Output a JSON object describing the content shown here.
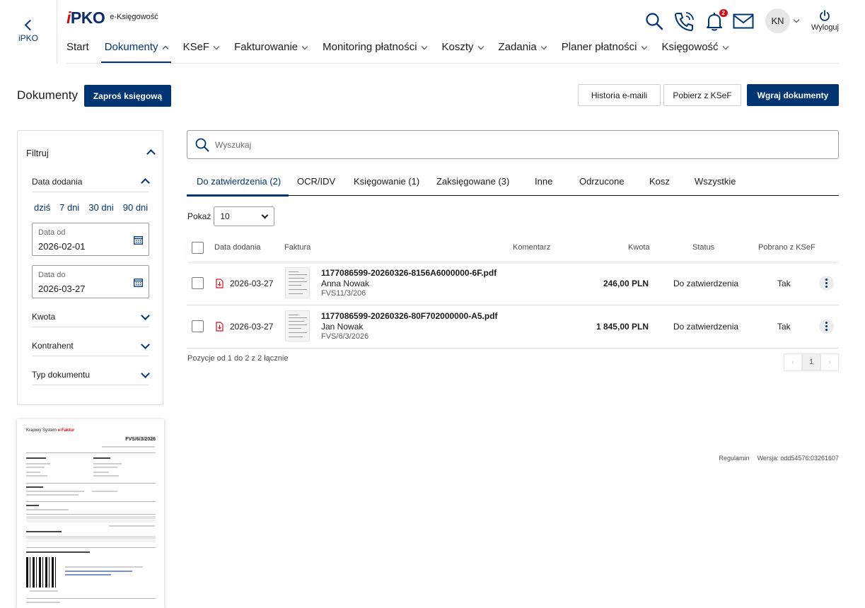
{
  "header": {
    "back_label": "iPKO",
    "brand_i": "i",
    "brand_rest": "PKO",
    "brand_sub": "e-Księgowość",
    "nav": [
      "Start",
      "Dokumenty",
      "KSeF",
      "Fakturowanie",
      "Monitoring płatności",
      "Koszty",
      "Zadania",
      "Planer płatności",
      "Księgowość"
    ],
    "notification_count": "2",
    "avatar_initials": "KN",
    "logout_label": "Wyloguj"
  },
  "page": {
    "title": "Dokumenty",
    "invite_button": "Zaproś księgową",
    "email_history_button": "Historia e-maili",
    "ksef_download_button": "Pobierz z KSeF",
    "upload_button": "Wgraj dokumenty"
  },
  "filters": {
    "title": "Filtruj",
    "date_section": "Data dodania",
    "quick": [
      "dziś",
      "7 dni",
      "30 dni",
      "90 dni"
    ],
    "date_from_label": "Data od",
    "date_from_value": "2026-02-01",
    "date_to_label": "Data do",
    "date_to_value": "2026-03-27",
    "amount": "Kwota",
    "counterparty": "Kontrahent",
    "doc_type": "Typ dokumentu"
  },
  "preview": {
    "title_pre": "Krajowy System ",
    "title_e": "e-Faktur",
    "doc_number": "FVS/6/3/2026"
  },
  "search": {
    "placeholder": "Wyszukaj"
  },
  "tabs": [
    "Do zatwierdzenia (2)",
    "OCR/IDV",
    "Księgowanie (1)",
    "Zaksięgowane (3)",
    "Inne",
    "Odrzucone",
    "Kosz",
    "Wszystkie"
  ],
  "show": {
    "label": "Pokaż",
    "value": "10"
  },
  "table": {
    "columns": {
      "date": "Data dodania",
      "invoice": "Faktura",
      "comment": "Komentarz",
      "amount": "Kwota",
      "status": "Status",
      "ksef": "Pobrano z KSeF"
    },
    "rows": [
      {
        "date": "2026-03-27",
        "file": "1177086599-20260326-8156A6000000-6F.pdf",
        "contractor": "Anna Nowak",
        "number": "FVS11/3/206",
        "amount": "246,00 PLN",
        "status": "Do zatwierdzenia",
        "ksef": "Tak"
      },
      {
        "date": "2026-03-27",
        "file": "1177086599-20260326-80F702000000-A5.pdf",
        "contractor": "Jan Nowak",
        "number": "FVS/6/3/2026",
        "amount": "1 845,00 PLN",
        "status": "Do zatwierdzenia",
        "ksef": "Tak"
      }
    ]
  },
  "summary": "Pozycje od 1 do 2 z 2 łącznie",
  "pagination": {
    "prev": "‹",
    "current": "1",
    "next": "›"
  },
  "footer": {
    "terms": "Regulamin",
    "version": "Wersja: odd54576:03261607"
  },
  "colors": {
    "primary": "#003574",
    "accent_red": "#d00f1b",
    "border": "#dcdcdc"
  }
}
